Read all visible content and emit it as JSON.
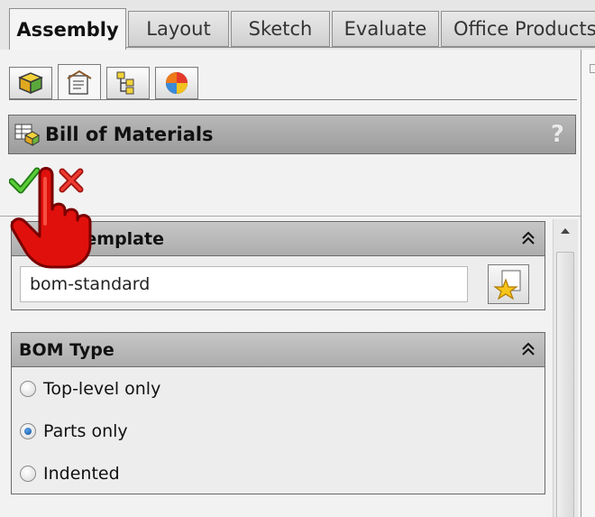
{
  "tabs": [
    {
      "label": "Assembly",
      "active": true
    },
    {
      "label": "Layout",
      "active": false
    },
    {
      "label": "Sketch",
      "active": false
    },
    {
      "label": "Evaluate",
      "active": false
    },
    {
      "label": "Office Products",
      "active": false
    }
  ],
  "panel_tabs": [
    {
      "icon": "feature-manager-icon",
      "active": false
    },
    {
      "icon": "property-manager-icon",
      "active": true
    },
    {
      "icon": "configuration-manager-icon",
      "active": false
    },
    {
      "icon": "display-manager-icon",
      "active": false
    }
  ],
  "property_manager": {
    "title": "Bill of Materials",
    "help": "?",
    "ok_icon": "ok-check-icon",
    "cancel_icon": "cancel-x-icon"
  },
  "table_template": {
    "title": "Table Template",
    "value": "bom-standard",
    "favorite_icon": "add-favorite-star-icon"
  },
  "bom_type": {
    "title": "BOM Type",
    "options": [
      {
        "label": "Top-level only",
        "checked": false
      },
      {
        "label": "Parts only",
        "checked": true
      },
      {
        "label": "Indented",
        "checked": false
      }
    ]
  },
  "cursor": "hand-pointer-cursor",
  "colors": {
    "header_gray": "#a9a9a9",
    "radio_selected": "#1a5fb4",
    "ok_green": "#2f9a1c",
    "cancel_red": "#d0201c",
    "cursor_red": "#e0100c"
  }
}
